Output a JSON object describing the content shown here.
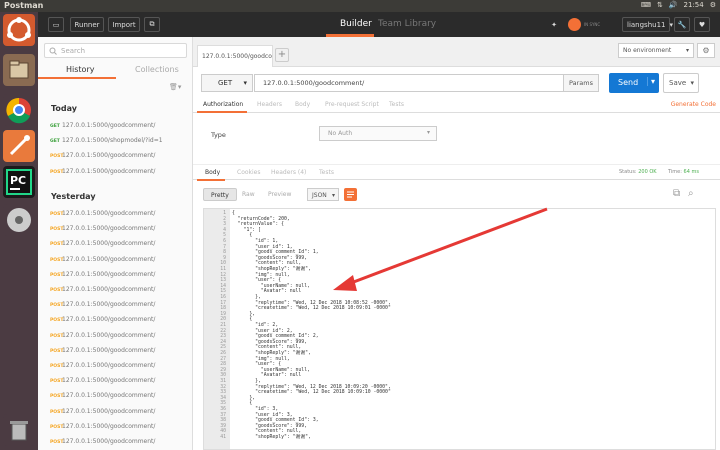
{
  "system": {
    "app_name": "Postman",
    "time": "21:54"
  },
  "header": {
    "runner": "Runner",
    "import": "Import",
    "tabs": [
      "Builder",
      "Team Library"
    ],
    "sync_label": "IN SYNC",
    "user": "liangshu11"
  },
  "sidebar": {
    "search_placeholder": "Search",
    "tabs": [
      "History",
      "Collections"
    ],
    "today_label": "Today",
    "yesterday_label": "Yesterday",
    "today_items": [
      {
        "method": "GET",
        "url": "127.0.0.1:5000/goodcomment/"
      },
      {
        "method": "GET",
        "url": "127.0.0.1:5000/shopmodel/?id=1"
      },
      {
        "method": "POST",
        "url": "127.0.0.1:5000/goodcomment/"
      },
      {
        "method": "POST",
        "url": "127.0.0.1:5000/goodcomment/"
      }
    ],
    "yesterday_items": [
      {
        "method": "POST",
        "url": "127.0.0.1:5000/goodcomment/"
      },
      {
        "method": "POST",
        "url": "127.0.0.1:5000/goodcomment/"
      },
      {
        "method": "POST",
        "url": "127.0.0.1:5000/goodcomment/"
      },
      {
        "method": "POST",
        "url": "127.0.0.1:5000/goodcomment/"
      },
      {
        "method": "POST",
        "url": "127.0.0.1:5000/goodcomment/"
      },
      {
        "method": "POST",
        "url": "127.0.0.1:5000/goodcomment/"
      },
      {
        "method": "POST",
        "url": "127.0.0.1:5000/goodcomment/"
      },
      {
        "method": "POST",
        "url": "127.0.0.1:5000/goodcomment/"
      },
      {
        "method": "POST",
        "url": "127.0.0.1:5000/goodcomment/"
      },
      {
        "method": "POST",
        "url": "127.0.0.1:5000/goodcomment/"
      },
      {
        "method": "POST",
        "url": "127.0.0.1:5000/goodcomment/"
      },
      {
        "method": "POST",
        "url": "127.0.0.1:5000/goodcomment/"
      },
      {
        "method": "POST",
        "url": "127.0.0.1:5000/goodcomment/"
      },
      {
        "method": "POST",
        "url": "127.0.0.1:5000/goodcomment/"
      },
      {
        "method": "POST",
        "url": "127.0.0.1:5000/goodcomment/"
      },
      {
        "method": "POST",
        "url": "127.0.0.1:5000/goodcomment/"
      }
    ]
  },
  "request": {
    "tab_label": "127.0.0.1:5000/goodcomm",
    "environment": "No environment",
    "method": "GET",
    "url": "127.0.0.1:5000/goodcomment/",
    "params": "Params",
    "send": "Send",
    "save": "Save",
    "subtabs": [
      "Authorization",
      "Headers",
      "Body",
      "Pre-request Script",
      "Tests"
    ],
    "generate_code": "Generate Code",
    "type_label": "Type",
    "auth_value": "No Auth"
  },
  "response": {
    "tabs": [
      "Body",
      "Cookies",
      "Headers (4)",
      "Tests"
    ],
    "status_label": "Status:",
    "status_value": "200 OK",
    "time_label": "Time:",
    "time_value": "64 ms",
    "view_modes": [
      "Pretty",
      "Raw",
      "Preview"
    ],
    "format": "JSON",
    "lines": [
      "{",
      "  \"returnCode\": 200,",
      "  \"returnValue\": {",
      "    \"1\": [",
      "      {",
      "        \"id\": 1,",
      "        \"user_id\": 1,",
      "        \"goods_comment_Id\": 1,",
      "        \"goodsScore\": 999,",
      "        \"content\": null,",
      "        \"shopReply\": \"谢谢\",",
      "        \"img\": null,",
      "        \"user\": {",
      "          \"userName\": null,",
      "          \"Avatar\": null",
      "        },",
      "        \"replytime\": \"Wed, 12 Dec 2018 10:08:52 -0000\",",
      "        \"createtime\": \"Wed, 12 Dec 2018 10:09:01 -0000\"",
      "      },",
      "      {",
      "        \"id\": 2,",
      "        \"user_id\": 2,",
      "        \"goods_comment_Id\": 2,",
      "        \"goodsScore\": 999,",
      "        \"content\": null,",
      "        \"shopReply\": \"谢谢\",",
      "        \"img\": null,",
      "        \"user\": {",
      "          \"userName\": null,",
      "          \"Avatar\": null",
      "        },",
      "        \"replytime\": \"Wed, 12 Dec 2018 10:09:20 -0000\",",
      "        \"createtime\": \"Wed, 12 Dec 2018 10:09:10 -0000\"",
      "      },",
      "      {",
      "        \"id\": 3,",
      "        \"user_id\": 3,",
      "        \"goods_comment_Id\": 3,",
      "        \"goodsScore\": 999,",
      "        \"content\": null,",
      "        \"shopReply\": \"谢谢\","
    ]
  },
  "colors": {
    "accent": "#f37036",
    "send": "#1478d4",
    "header": "#2b2b2b",
    "launcher": "#4b3b42"
  }
}
